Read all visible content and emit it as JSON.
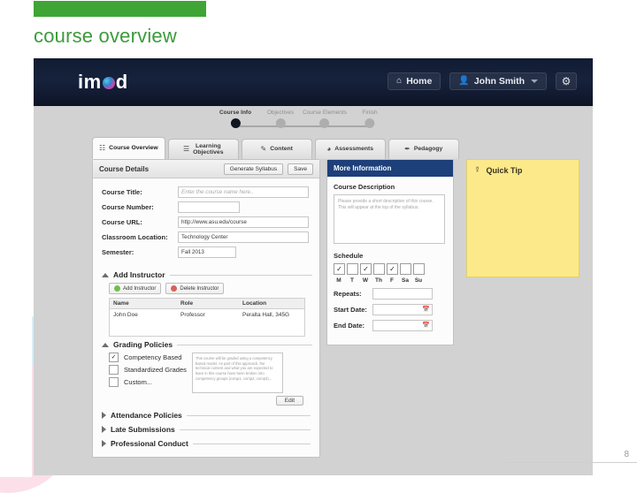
{
  "slide": {
    "title": "course overview",
    "page_number": "8",
    "accent_green": "#3fa535",
    "title_color": "#3c9a3c"
  },
  "app": {
    "logo": {
      "before": "im",
      "dot": "logo-dot",
      "after": "d"
    },
    "nav": {
      "home": {
        "label": "Home",
        "icon": "home-icon"
      },
      "user": {
        "label": "John Smith",
        "icon": "user-icon"
      },
      "settings": {
        "icon": "gear-icon",
        "glyph": "⚙"
      }
    },
    "steps": [
      {
        "label": "Course Info",
        "active": true
      },
      {
        "label": "Objectives",
        "active": false
      },
      {
        "label": "Course Elements",
        "active": false
      },
      {
        "label": "Finish",
        "active": false
      }
    ],
    "tabs": [
      {
        "label": "Course Overview",
        "icon": "book-icon",
        "glyph": "☷",
        "active": true
      },
      {
        "label": "Learning\nObjectives",
        "icon": "list-icon",
        "glyph": "☰",
        "active": false
      },
      {
        "label": "Content",
        "icon": "edit-icon",
        "glyph": "✎",
        "active": false
      },
      {
        "label": "Assessments",
        "icon": "pie-chart-icon",
        "glyph": "◕",
        "active": false
      },
      {
        "label": "Pedagogy",
        "icon": "graduation-icon",
        "glyph": "✒",
        "active": false
      }
    ],
    "course_details": {
      "title": "Course Details",
      "generate_syllabus_label": "Generate Syllabus",
      "save_label": "Save",
      "fields": [
        {
          "label": "Course Title:",
          "value": "",
          "placeholder": "Enter the course name here.."
        },
        {
          "label": "Course Number:",
          "value": "",
          "placeholder": ""
        },
        {
          "label": "Course URL:",
          "value": "http://www.asu.edu/course",
          "placeholder": ""
        },
        {
          "label": "Classroom Location:",
          "value": "Technology Center",
          "placeholder": ""
        },
        {
          "label": "Semester:",
          "value": "Fall 2013",
          "placeholder": ""
        }
      ]
    },
    "add_instructor": {
      "title": "Add Instructor",
      "add_label": "Add Instructor",
      "delete_label": "Delete Instructor",
      "columns": [
        "Name",
        "Role",
        "Location"
      ],
      "rows": [
        [
          "John Doe",
          "Professor",
          "Peralta Hall, 345G"
        ]
      ]
    },
    "grading_policies": {
      "title": "Grading Policies",
      "options": [
        {
          "label": "Competency Based",
          "checked": true
        },
        {
          "label": "Standardized Grades",
          "checked": false
        },
        {
          "label": "Custom...",
          "checked": false
        }
      ],
      "note": "This course will be graded using a competency based model. As part of this approach, the technical content and what you are expected to learn in this course have been broken into competency groups (comp1, comp2, comp3)...",
      "edit_label": "Edit"
    },
    "accordions": [
      {
        "label": "Attendance Policies"
      },
      {
        "label": "Late Submissions"
      },
      {
        "label": "Professional Conduct"
      }
    ],
    "more_information": {
      "title": "More Information",
      "course_description_label": "Course Description",
      "course_description_placeholder": "Please provide a short description of this course. This will appear at the top of the syllabus.",
      "schedule": {
        "title": "Schedule",
        "days": [
          {
            "name": "M",
            "checked": true
          },
          {
            "name": "T",
            "checked": false
          },
          {
            "name": "W",
            "checked": true
          },
          {
            "name": "Th",
            "checked": false
          },
          {
            "name": "F",
            "checked": true
          },
          {
            "name": "Sa",
            "checked": false
          },
          {
            "name": "Su",
            "checked": false
          }
        ],
        "rows": [
          {
            "label": "Repeats:",
            "value": "",
            "calendar": false
          },
          {
            "label": "Start Date:",
            "value": "",
            "calendar": true
          },
          {
            "label": "End Date:",
            "value": "",
            "calendar": true
          }
        ]
      }
    },
    "quick_tip": {
      "title": "Quick Tip",
      "icon": "lightbulb-icon",
      "glyph": "Ὂ1",
      "body": ""
    }
  }
}
